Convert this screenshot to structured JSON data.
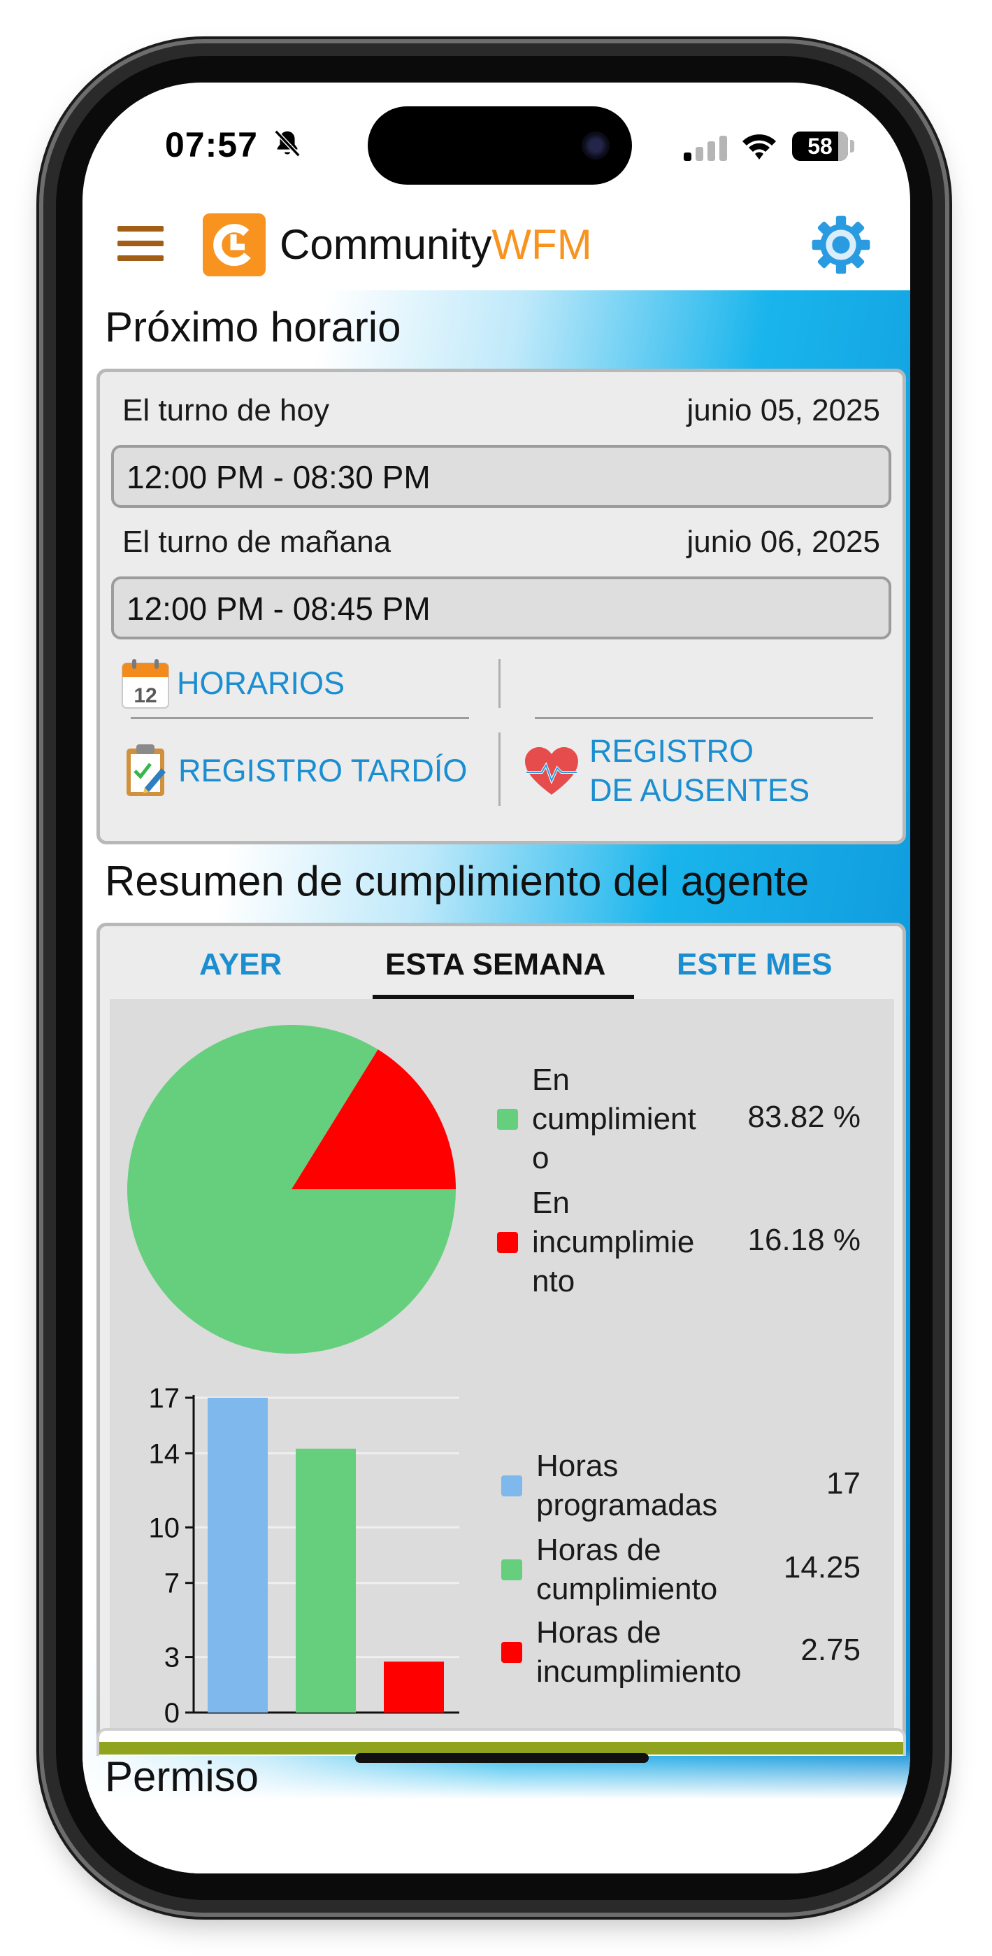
{
  "status_bar": {
    "time": "07:57",
    "battery": "58"
  },
  "header": {
    "brand_primary": "Community",
    "brand_accent": "WFM",
    "accent_color": "#f7931e"
  },
  "schedule": {
    "title": "Próximo horario",
    "today_label": "El turno de hoy",
    "today_date": "junio 05, 2025",
    "today_shift": "12:00 PM - 08:30 PM",
    "tomorrow_label": "El turno de mañana",
    "tomorrow_date": "junio 06, 2025",
    "tomorrow_shift": "12:00 PM - 08:45 PM",
    "calendar_day": "12",
    "links": {
      "horarios": "HORARIOS",
      "registro_tardio": "REGISTRO TARDÍO",
      "registro_ausentes_line1": "REGISTRO",
      "registro_ausentes_line2": "DE AUSENTES"
    }
  },
  "compliance": {
    "title": "Resumen de cumplimiento del agente",
    "tabs": [
      "AYER",
      "ESTA SEMANA",
      "ESTE MES"
    ],
    "active_tab": "ESTA SEMANA",
    "pie_legend": [
      {
        "label_lines": [
          "En",
          "cumplimient",
          "o"
        ],
        "value": "83.82 %"
      },
      {
        "label_lines": [
          "En",
          "incumplimie",
          "nto"
        ],
        "value": "16.18 %"
      }
    ],
    "bar_legend": [
      {
        "label_lines": [
          "Horas",
          "programadas"
        ],
        "value": "17"
      },
      {
        "label_lines": [
          "Horas de",
          "cumplimiento"
        ],
        "value": "14.25"
      },
      {
        "label_lines": [
          "Horas de",
          "incumplimiento"
        ],
        "value": "2.75"
      }
    ]
  },
  "permiso": {
    "title": "Permiso"
  },
  "chart_data": [
    {
      "type": "pie",
      "labels": [
        "En cumplimiento",
        "En incumplimiento"
      ],
      "values": [
        83.82,
        16.18
      ],
      "colors": [
        "#66cf7e",
        "#ff0000"
      ]
    },
    {
      "type": "bar",
      "categories": [
        "Horas programadas",
        "Horas de cumplimiento",
        "Horas de incumplimiento"
      ],
      "values": [
        17,
        14.25,
        2.75
      ],
      "colors": [
        "#7fb8ec",
        "#66cf7e",
        "#ff0000"
      ],
      "yticks": [
        "0",
        "3",
        "7",
        "10",
        "14",
        "17"
      ],
      "ylim": [
        0,
        17
      ]
    }
  ]
}
